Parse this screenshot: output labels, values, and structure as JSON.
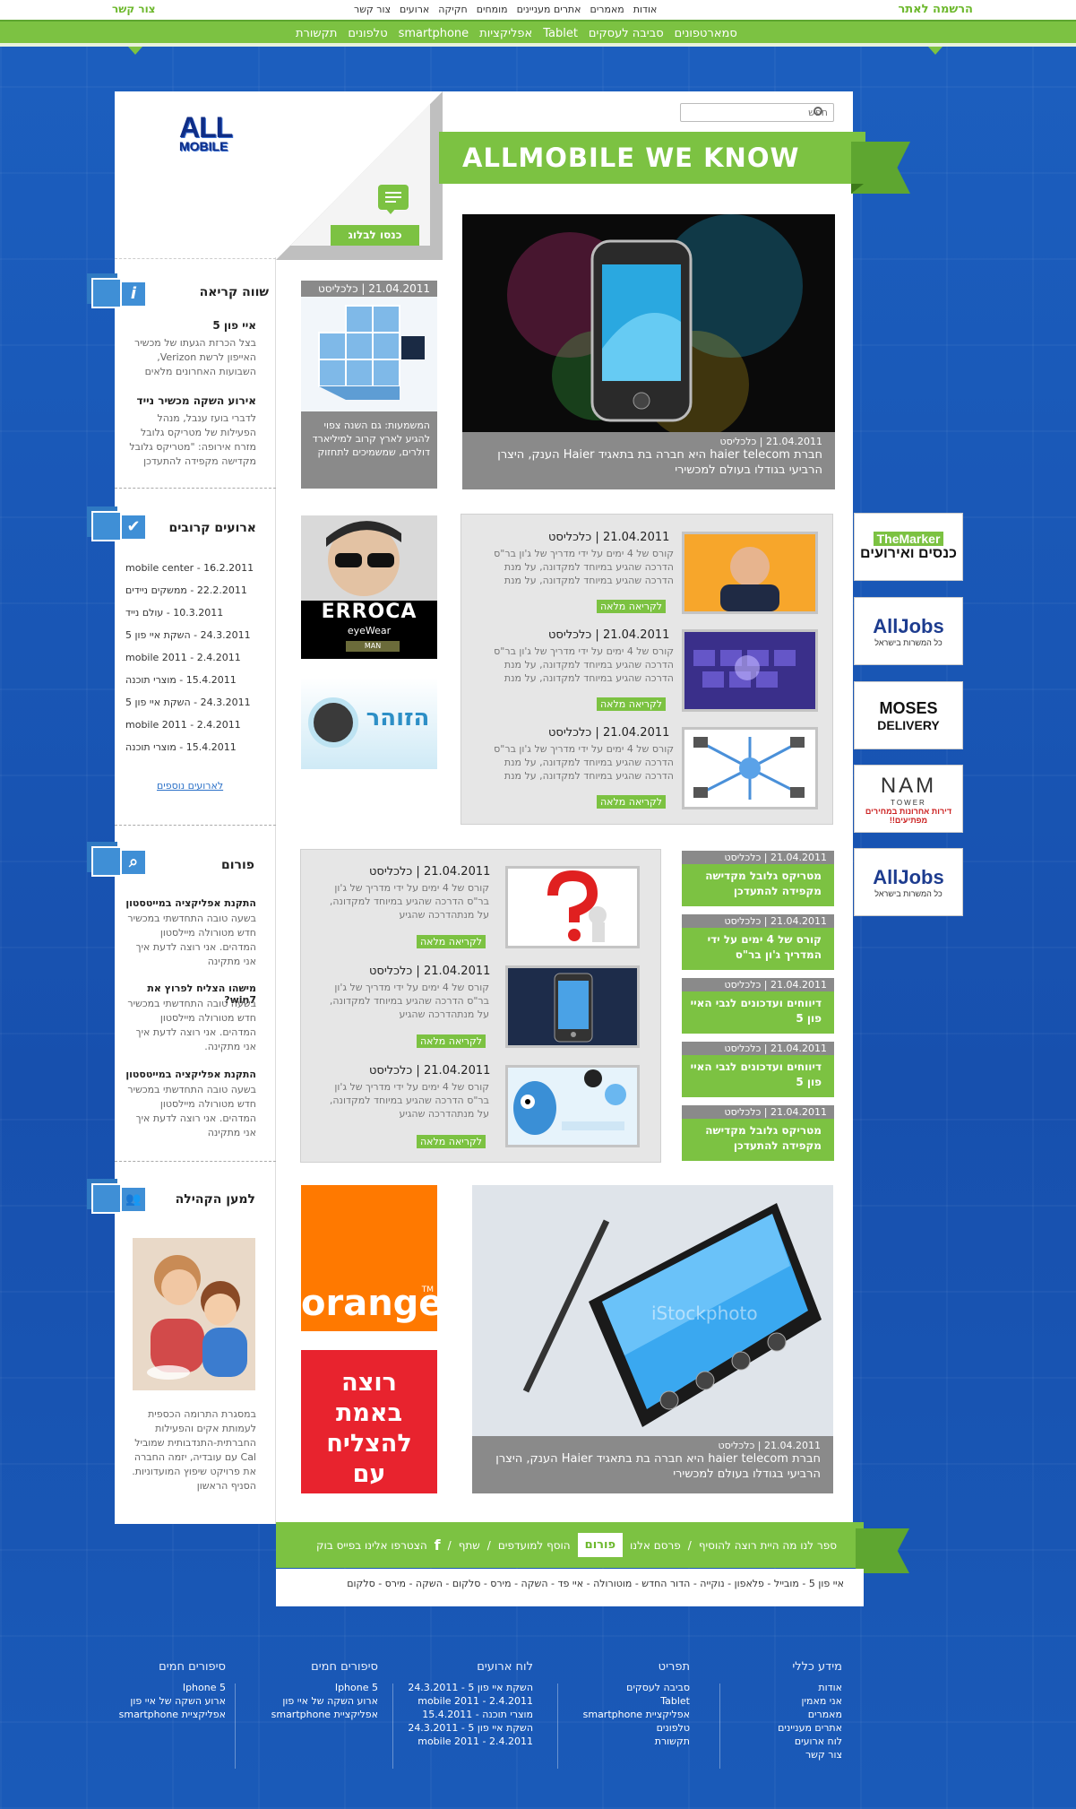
{
  "header": {
    "join": "הרשמה לאתר",
    "contact": "צור קשר",
    "top_links": [
      "אודות",
      "מאמרים",
      "אתרים מעניינים",
      "מומחים",
      "חקיקה",
      "ארועים",
      "צור קשר"
    ],
    "nav": [
      "סמארטפונים",
      "סביבה לעסקים",
      "Tablet",
      "אפליקציות",
      "smartphone",
      "טלפונים",
      "תקשורת"
    ]
  },
  "logo": {
    "line1": "ALL",
    "line2": "MOBILE"
  },
  "search": {
    "placeholder": "חפש"
  },
  "title": "ALLMOBILE WE KNOW",
  "blog": {
    "label": "כנסו לבלוג"
  },
  "featured": [
    {
      "meta": "21.04.2011 | כלכליסט",
      "text": "חברת haier telecom היא חברה בת בתאגיד Haier הענק, היצרן הרביעי בגודלו בעולם למכשירי"
    },
    {
      "meta": "21.04.2011 | כלכליסט",
      "text": "חברת haier telecom היא חברה בת בתאגיד Haier הענק, היצרן הרביעי בגודלו בעולם למכשירי"
    }
  ],
  "side_article": {
    "meta": "21.04.2011 | כלכליסט",
    "text": "המשמעות: גם השנה צפוי להגיע לארץ קרוב למיליארד דולרים, שמשמיכים לתחזוק"
  },
  "sidebar": {
    "worth": {
      "title": "שווה קריאה",
      "items": [
        {
          "title": "איי פון 5",
          "text": "בצל הכרזת הגעתו של מכשיר האייפון לרשת Verizon, השבועות האחרונים מלאים"
        },
        {
          "title": "אירוע השקה מכשיר נייד",
          "text": "לדברי בועז ענבל, מנהל הפעילות של מטריקס גלובל מזרח אירופה: \"מטריקס גלובל מקדישה מקפידה להתעדכן"
        }
      ]
    },
    "events": {
      "title": "ארועים קרובים",
      "items": [
        {
          "date": "16.2.2011",
          "name": "mobile center"
        },
        {
          "date": "22.2.2011",
          "name": "ממשקים ניידים"
        },
        {
          "date": "10.3.2011",
          "name": "עולם נייד"
        },
        {
          "date": "24.3.2011",
          "name": "השקת איי פון 5"
        },
        {
          "date": "2.4.2011",
          "name": "mobile 2011"
        },
        {
          "date": "15.4.2011",
          "name": "מוצרי תוכנה"
        },
        {
          "date": "24.3.2011",
          "name": "השקת איי פון 5"
        },
        {
          "date": "2.4.2011",
          "name": "mobile 2011"
        },
        {
          "date": "15.4.2011",
          "name": "מוצרי תוכנה"
        }
      ],
      "more": "לארועים נוספים"
    },
    "forum": {
      "title": "פורום",
      "items": [
        {
          "title": "התקנת אפליקציה במייטסטון",
          "text": "בשעה טובה התחדשתי במכשיר חדש מטורולה מיילסטון המדהים. אני רוצה לדעת איך אני מתקינה"
        },
        {
          "title": "מישהו הצליח לפרוץ את win7?",
          "text": "בשעה טובה התחדשתי במכשיר חדש מטורולה מיילסטון המדהים. אני רוצה לדעת איך אני מתקינה."
        },
        {
          "title": "התקנת אפליקציה במייטסטון",
          "text": "בשעה טובה התחדשתי במכשיר חדש מטורולה מיילסטון המדהים. אני רוצה לדעת איך אני מתקינה"
        }
      ]
    },
    "community": {
      "title": "למען הקהילה",
      "text": "במסגרת התרומה הכספית לעמותת אקים והפעילות החברתית-התנדבותית שמוביל Cal עם עובדיה, יזמה החברה את פרויקט שיפוץ המועדוניות. הסניף הראשון"
    }
  },
  "news1": [
    {
      "meta": "21.04.2011 | כלכליסט",
      "text": "קורס של 4 ימים על ידי מדריך של ג'ון בר\"ס הדרכה שהגיע במיוחד למקדונה, על מנת הדרכה שהגיע במיוחד למקדונה, על מנת",
      "more": "לקריאה מלאה"
    },
    {
      "meta": "21.04.2011 | כלכליסט",
      "text": "קורס של 4 ימים על ידי מדריך של ג'ון בר\"ס הדרכה שהגיע במיוחד למקדונה, על מנת הדרכה שהגיע במיוחד למקדונה, על מנת",
      "more": "לקריאה מלאה"
    },
    {
      "meta": "21.04.2011 | כלכליסט",
      "text": "קורס של 4 ימים על ידי מדריך של ג'ון בר\"ס הדרכה שהגיע במיוחד למקדונה, על מנת הדרכה שהגיע במיוחד למקדונה, על מנת",
      "more": "לקריאה מלאה"
    }
  ],
  "news2": [
    {
      "meta": "21.04.2011 | כלכליסט",
      "text": "קורס של 4 ימים על ידי מדריך של ג'ון בר\"ס הדרכה שהגיע במיוחד למקדונה, על מנתהדרכה שהגיע",
      "more": "לקריאה מלאה"
    },
    {
      "meta": "21.04.2011 | כלכליסט",
      "text": "קורס של 4 ימים על ידי מדריך של ג'ון בר\"ס הדרכה שהגיע במיוחד למקדונה, על מנתהדרכה שהגיע",
      "more": "לקריאה מלאה"
    },
    {
      "meta": "21.04.2011 | כלכליסט",
      "text": "קורס של 4 ימים על ידי מדריך של ג'ון בר\"ס הדרכה שהגיע במיוחד למקדונה, על מנתהדרכה שהגיע",
      "more": "לקריאה מלאה"
    }
  ],
  "green_list": [
    {
      "meta": "21.04.2011 | כלכליסט",
      "text": "מטריקס גלובל מקדישה מקפידה להתעדכן"
    },
    {
      "meta": "21.04.2011 | כלכליסט",
      "text": "קורס של 4 ימים על ידי המדריך ג'ון בר\"ס"
    },
    {
      "meta": "21.04.2011 | כלכליסט",
      "text": "דיווחים ועדכונים לגבי האיי פון 5"
    },
    {
      "meta": "21.04.2011 | כלכליסט",
      "text": "דיווחים ועדכונים לגבי האיי פון 5"
    },
    {
      "meta": "21.04.2011 | כלכליסט",
      "text": "מטריקס גלובל מקדישה מקפידה להתעדכן"
    }
  ],
  "ads": {
    "erroca": {
      "name": "ERROCA",
      "sub": "eyeWear",
      "sub2": "MAN"
    },
    "hazoher": {
      "text": "הזוהר"
    },
    "orange": {
      "text": "orange",
      "tm": "TM"
    },
    "success": {
      "text": "רוצה באמת להצליח עם המתנה?"
    },
    "themarker": {
      "name": "TheMarker",
      "sub": "כנסים ואירועים"
    },
    "alljobs1": {
      "name": "AllJobs",
      "sub": "כל המשרות בישראל"
    },
    "moses": {
      "name": "MOSES",
      "sub": "DELIVERY"
    },
    "nam": {
      "name": "NAM",
      "sub2": "TOWER",
      "sub": "דירות אחרונות במחירים מפתיעים!!"
    },
    "alljobs2": {
      "name": "AllJobs",
      "sub": "כל המשרות בישראל"
    },
    "watermark": "iStockphoto"
  },
  "bottom_bar": {
    "items": [
      "ספר לנו מה היית רוצה להוסיף",
      "פרסם אלנו",
      "פורום",
      "הוסף למועדפים",
      "שתף",
      "הצטרפו אלינו בפייס בוק"
    ],
    "fb": "f"
  },
  "tags": "איי פון 5 - מובייל - פלאפון - נוקייה - הדור החדש - מוטורולה - איי פד - השקה - מירס - סלקום - השקה - מירס - סלקום",
  "footer": {
    "general": {
      "title": "מידע כללי",
      "items": [
        "אודות",
        "אני מאמין",
        "מאמרים",
        "אתרים מעניינים",
        "לוח ארועים",
        "צור קשר"
      ]
    },
    "menu": {
      "title": "תפריט",
      "items": [
        "סביבה לעסקים",
        "Tablet",
        "אפליקציית smartphone",
        "טלפונים",
        "תקשורת"
      ]
    },
    "events": {
      "title": "לוח ארועים",
      "items": [
        {
          "date": "24.3.2011",
          "name": "השקת איי פון 5"
        },
        {
          "date": "2.4.2011",
          "name": "mobile 2011"
        },
        {
          "date": "15.4.2011",
          "name": "מוצרי תוכנה"
        },
        {
          "date": "24.3.2011",
          "name": "השקת איי פון 5"
        },
        {
          "date": "2.4.2011",
          "name": "mobile 2011"
        }
      ]
    },
    "hot1": {
      "title": "סיפורים חמים",
      "items": [
        "Iphone 5",
        "ארוע השקה של איי פון",
        "אפליקציית smartphone"
      ]
    },
    "hot2": {
      "title": "סיפורים חמים",
      "items": [
        "Iphone 5",
        "ארוע השקה של איי פון",
        "אפליקציית smartphone"
      ]
    }
  }
}
